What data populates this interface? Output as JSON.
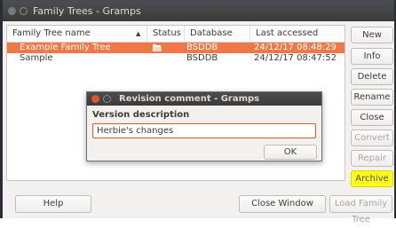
{
  "window": {
    "title": "Family Trees - Gramps"
  },
  "tree": {
    "columns": [
      "Family Tree name",
      "Status",
      "Database Type",
      "Last accessed"
    ],
    "rows": [
      {
        "name": "Example Family Tree",
        "db_type": "BSDDB",
        "last_accessed": "24/12/17 08:48:29",
        "selected": true,
        "status_icon": "open-folder-icon"
      },
      {
        "name": "Sample",
        "db_type": "BSDDB",
        "last_accessed": "24/12/17 08:47:52",
        "selected": false
      }
    ]
  },
  "side_buttons": [
    {
      "label": "New",
      "enabled": true
    },
    {
      "label": "Info",
      "enabled": true
    },
    {
      "label": "Delete",
      "enabled": true
    },
    {
      "label": "Rename",
      "enabled": true
    },
    {
      "label": "Close",
      "enabled": true
    },
    {
      "label": "Convert",
      "enabled": false
    },
    {
      "label": "Repair",
      "enabled": false
    },
    {
      "label": "Archive",
      "enabled": true,
      "highlighted": true
    }
  ],
  "bottom_buttons": {
    "help": "Help",
    "close_window": "Close Window",
    "load": "Load Family Tree"
  },
  "dialog": {
    "title": "Revision comment - Gramps",
    "label": "Version description",
    "input_value": "Herbie's changes",
    "ok": "OK"
  },
  "colors": {
    "selection": "#f07746",
    "highlight": "#ffff1a"
  }
}
